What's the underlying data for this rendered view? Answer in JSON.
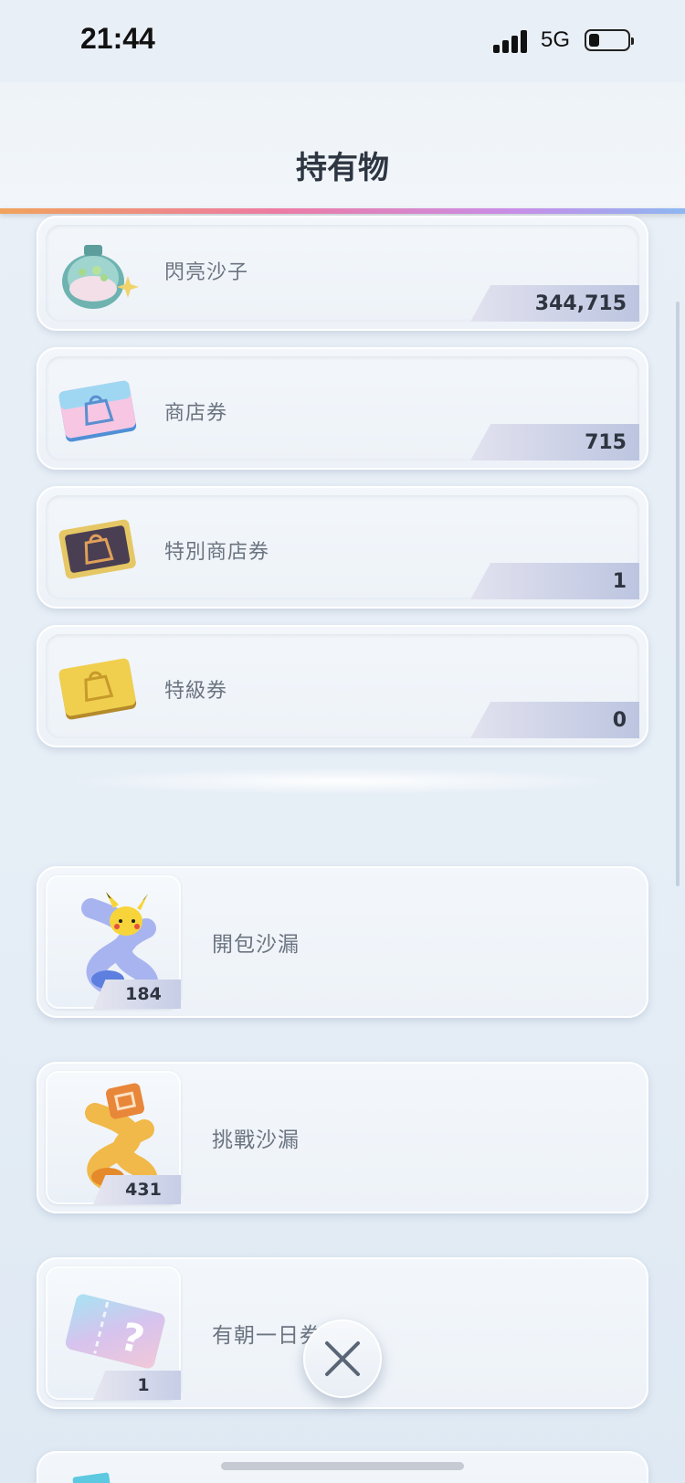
{
  "status_bar": {
    "time": "21:44",
    "network": "5G",
    "battery_percent": 20
  },
  "header": {
    "title": "持有物"
  },
  "currencies": [
    {
      "name": "閃亮沙子",
      "count": "344,715",
      "icon": "shiny-sand-bottle-icon"
    },
    {
      "name": "商店券",
      "count": "715",
      "icon": "shop-ticket-icon"
    },
    {
      "name": "特別商店券",
      "count": "1",
      "icon": "special-shop-ticket-icon"
    },
    {
      "name": "特級券",
      "count": "0",
      "icon": "premium-ticket-icon"
    }
  ],
  "hourglasses": [
    {
      "name": "開包沙漏",
      "count": "184",
      "icon": "pack-hourglass-icon"
    },
    {
      "name": "挑戰沙漏",
      "count": "431",
      "icon": "challenge-hourglass-icon"
    },
    {
      "name": "有朝一日券",
      "count": "1",
      "icon": "someday-ticket-icon"
    }
  ],
  "close_icon": "close-icon",
  "colors": {
    "accent_line": [
      "#f0a35c",
      "#ee7ca3",
      "#c98ee8",
      "#8db7f2"
    ]
  }
}
